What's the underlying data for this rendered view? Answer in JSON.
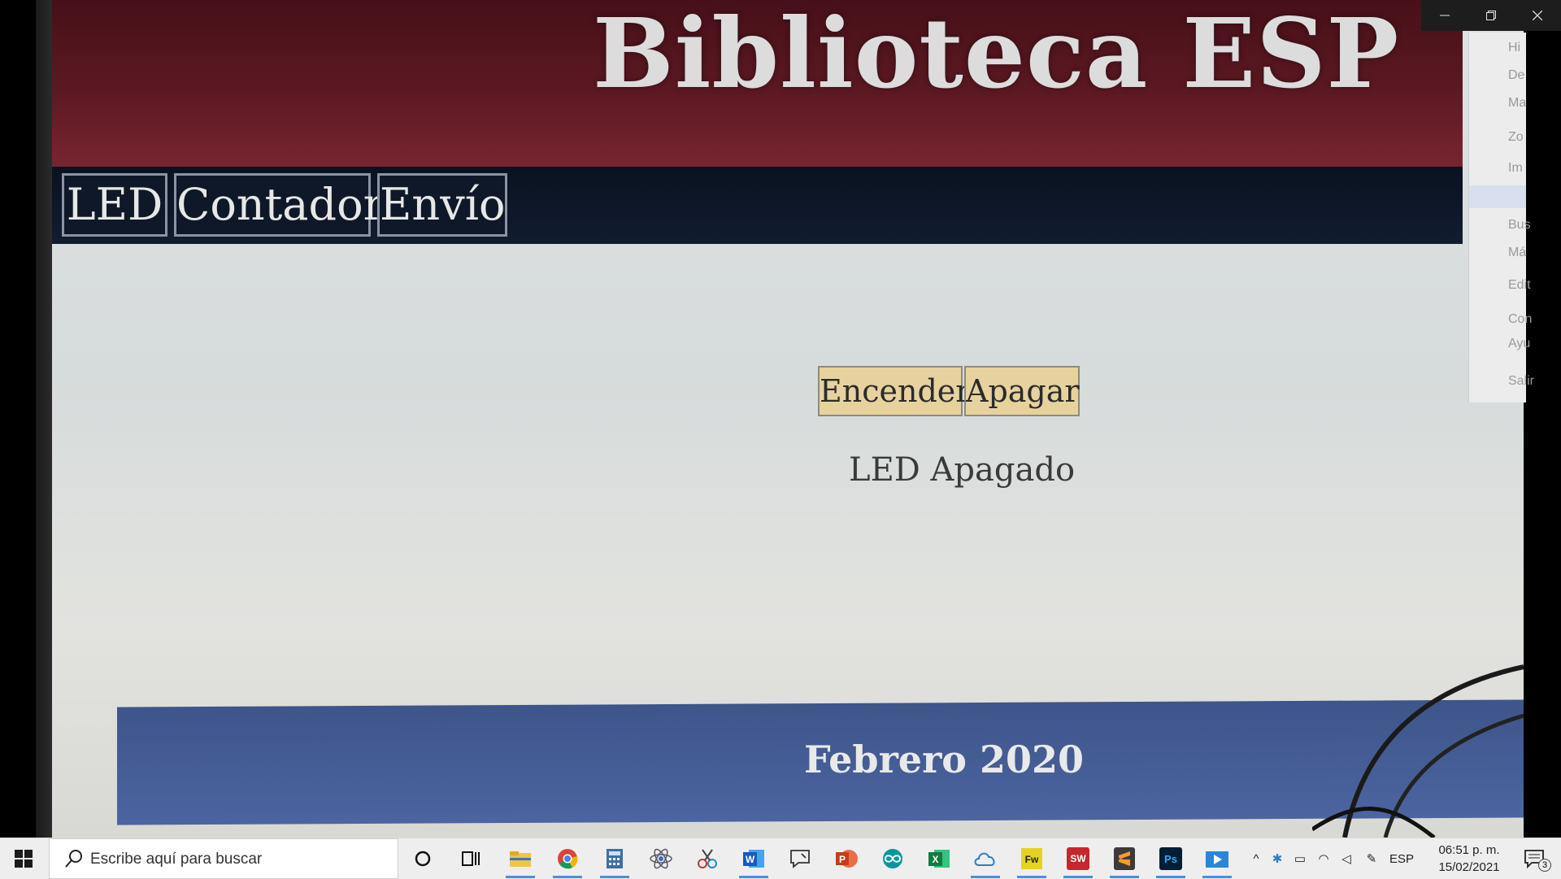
{
  "site": {
    "title": "Biblioteca ESP",
    "nav": [
      "LED",
      "Contador",
      "Envío"
    ],
    "buttons": {
      "on": "Encender",
      "off": "Apagar"
    },
    "status": "LED Apagado",
    "footer": "Febrero 2020"
  },
  "side_menu_peek": [
    "Hi",
    "De",
    "Ma",
    "Zo",
    "Im",
    "Bus",
    "Má",
    "Edit",
    "Con",
    "Ayu",
    "Salir"
  ],
  "taskbar": {
    "search_placeholder": "Escribe aquí para buscar",
    "apps": [
      "cortana-icon",
      "task-view-icon",
      "file-explorer-icon",
      "chrome-icon",
      "calculator-icon",
      "atom-icon",
      "snip-icon",
      "word-icon",
      "feedback-icon",
      "powerpoint-icon",
      "arduino-icon",
      "excel-icon",
      "cloud-icon",
      "fireworks-icon",
      "solidworks-icon",
      "sublime-icon",
      "photoshop-icon",
      "media-player-icon"
    ],
    "language": "ESP",
    "time": "06:51 p. m.",
    "date": "15/02/2021",
    "notifications": "3"
  },
  "colors": {
    "header": "#5a1822",
    "navbar": "#0f1828",
    "button": "#e7d29e",
    "footer": "#4c64a0"
  }
}
